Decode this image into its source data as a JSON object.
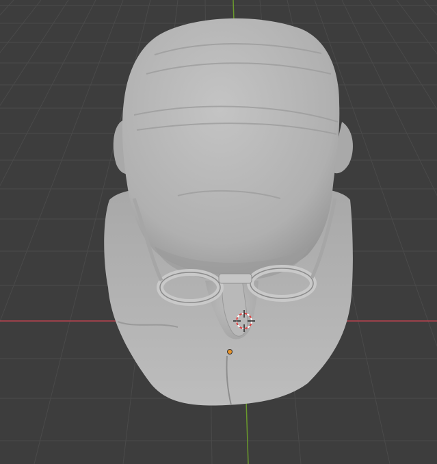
{
  "viewport": {
    "colors": {
      "background": "#3d3d3d",
      "grid_line": "#4a4a4a",
      "x_axis": "#b8434f",
      "y_axis": "#6a9a2c",
      "mesh": "#b4b4b4",
      "origin_marker": "#e8932a",
      "cursor_red": "#e04040",
      "cursor_white": "#ffffff"
    },
    "object": "bust-with-glasses-mesh",
    "icons": [
      "3d-cursor-icon",
      "origin-marker-icon"
    ]
  }
}
